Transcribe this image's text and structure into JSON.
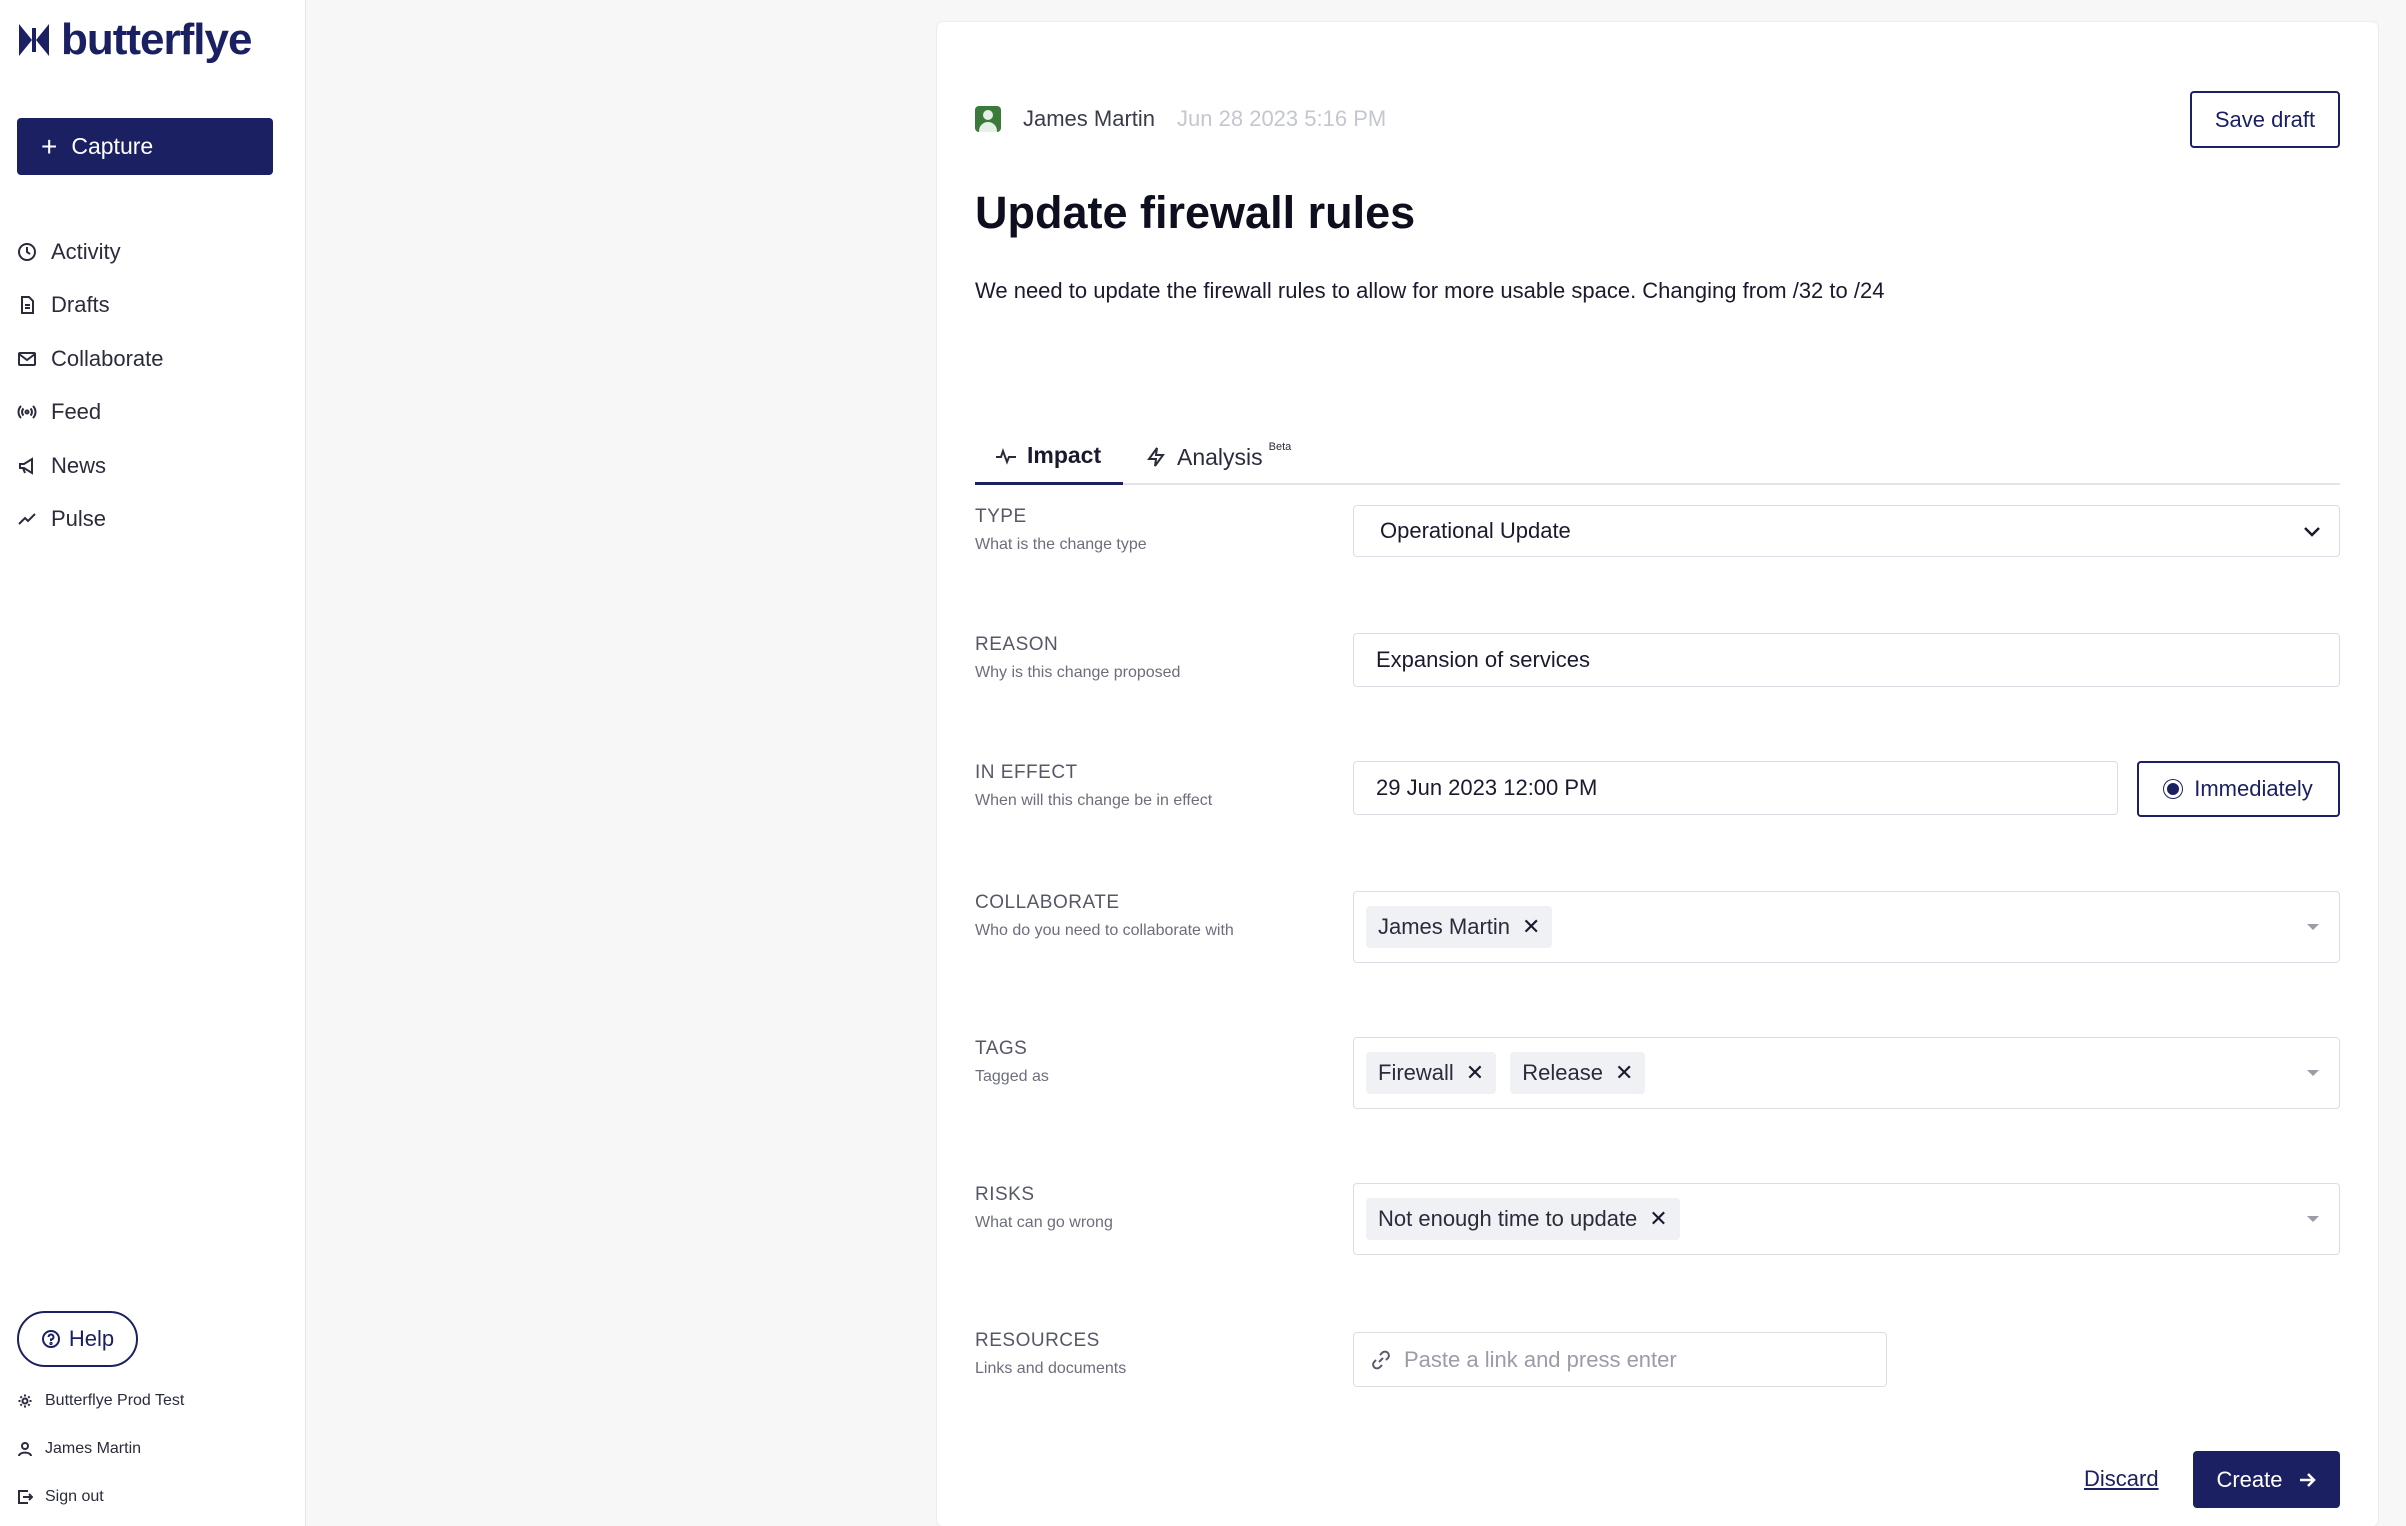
{
  "brand": {
    "name": "butterflye",
    "color": "#1b2062"
  },
  "sidebar": {
    "capture_label": "Capture",
    "items": [
      {
        "label": "Activity",
        "icon": "clock-icon"
      },
      {
        "label": "Drafts",
        "icon": "document-icon"
      },
      {
        "label": "Collaborate",
        "icon": "envelope-icon"
      },
      {
        "label": "Feed",
        "icon": "broadcast-icon"
      },
      {
        "label": "News",
        "icon": "megaphone-icon"
      },
      {
        "label": "Pulse",
        "icon": "trend-icon"
      }
    ],
    "help_label": "Help",
    "org_label": "Butterflye Prod Test",
    "user_label": "James Martin",
    "signout_label": "Sign out"
  },
  "post": {
    "author": "James Martin",
    "date": "Jun 28 2023 5:16 PM",
    "save_draft_label": "Save draft",
    "title": "Update firewall rules",
    "description": "We need to update the firewall rules to allow for more usable space.  Changing from /32 to /24"
  },
  "tabs": [
    {
      "label": "Impact",
      "active": true
    },
    {
      "label": "Analysis",
      "badge": "Beta",
      "active": false
    }
  ],
  "fields": {
    "type": {
      "label": "TYPE",
      "sub": "What is the change type",
      "value": "Operational Update"
    },
    "reason": {
      "label": "REASON",
      "sub": "Why is this change proposed",
      "value": "Expansion of services"
    },
    "in_effect": {
      "label": "IN EFFECT",
      "sub": "When will this change be in effect",
      "value": "29 Jun 2023 12:00 PM",
      "immediately_label": "Immediately"
    },
    "collaborate": {
      "label": "COLLABORATE",
      "sub": "Who do you need to collaborate with",
      "chips": [
        "James Martin"
      ]
    },
    "tags": {
      "label": "TAGS",
      "sub": "Tagged as",
      "chips": [
        "Firewall",
        "Release"
      ]
    },
    "risks": {
      "label": "RISKS",
      "sub": "What can go wrong",
      "chips": [
        "Not enough time to update"
      ]
    },
    "resources": {
      "label": "RESOURCES",
      "sub": "Links and documents",
      "placeholder": "Paste a link and press enter"
    }
  },
  "actions": {
    "discard_label": "Discard",
    "create_label": "Create"
  }
}
